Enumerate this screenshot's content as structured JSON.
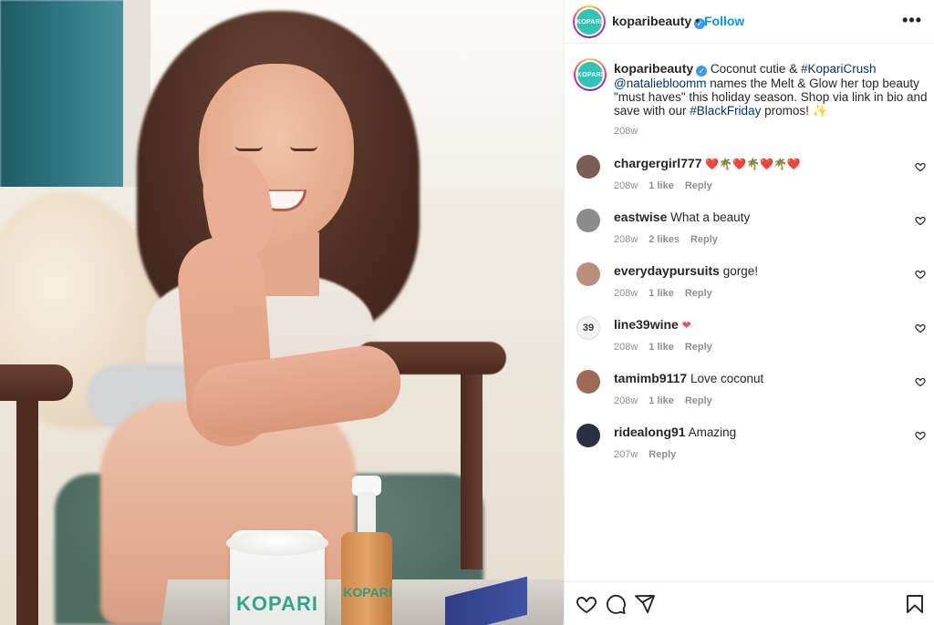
{
  "post": {
    "username": "koparibeauty",
    "avatar_text": "KOPARI",
    "follow_label": "Follow",
    "header_dot": "•",
    "more_label": "•••"
  },
  "caption": {
    "username": "koparibeauty",
    "text_prefix": " Coconut cutie & ",
    "hashtag1": "#KopariCrush",
    "mention": " @nataliebloomm",
    "text_middle": " names the Melt & Glow her top beauty \"must haves\" this holiday season. Shop via link in bio and save with our ",
    "hashtag2": "#BlackFriday",
    "text_suffix": " promos! ",
    "sparkle": "✨",
    "time": "208w"
  },
  "photo_products": {
    "jar_label": "KOPARI",
    "bottle_label": "KOPARI"
  },
  "comments": [
    {
      "username": "chargergirl777",
      "text": "",
      "emoji": "❤️🌴❤️🌴❤️🌴❤️",
      "time": "208w",
      "likes": "1 like",
      "reply": "Reply",
      "avatar_color": "#7a5e54"
    },
    {
      "username": "eastwise",
      "text": "What a beauty",
      "emoji": "",
      "time": "208w",
      "likes": "2 likes",
      "reply": "Reply",
      "avatar_color": "#8c8c8c"
    },
    {
      "username": "everydaypursuits",
      "text": "gorge!",
      "emoji": "",
      "time": "208w",
      "likes": "1 like",
      "reply": "Reply",
      "avatar_color": "#b98e7b"
    },
    {
      "username": "line39wine",
      "text": "",
      "emoji": "❤",
      "time": "208w",
      "likes": "1 like",
      "reply": "Reply",
      "avatar_color": "#f3f3f3"
    },
    {
      "username": "tamimb9117",
      "text": "Love coconut",
      "emoji": "",
      "time": "208w",
      "likes": "1 like",
      "reply": "Reply",
      "avatar_color": "#9e6b55"
    },
    {
      "username": "ridealong91",
      "text": "Amazing",
      "emoji": "",
      "time": "207w",
      "likes": "",
      "reply": "Reply",
      "avatar_color": "#2b3140"
    }
  ],
  "avatar_texts": {
    "line39wine": "39"
  },
  "icons": {
    "verified": "verified-badge-icon",
    "more": "more-options-icon",
    "heart": "heart-icon",
    "comment": "comment-icon",
    "share": "share-icon",
    "save": "bookmark-icon"
  },
  "colors": {
    "brand": "#2ec4b6",
    "link": "#0095f6",
    "hashtag": "#00376b",
    "muted": "#8e8e8e",
    "heart_emoji": "#ed4956"
  }
}
